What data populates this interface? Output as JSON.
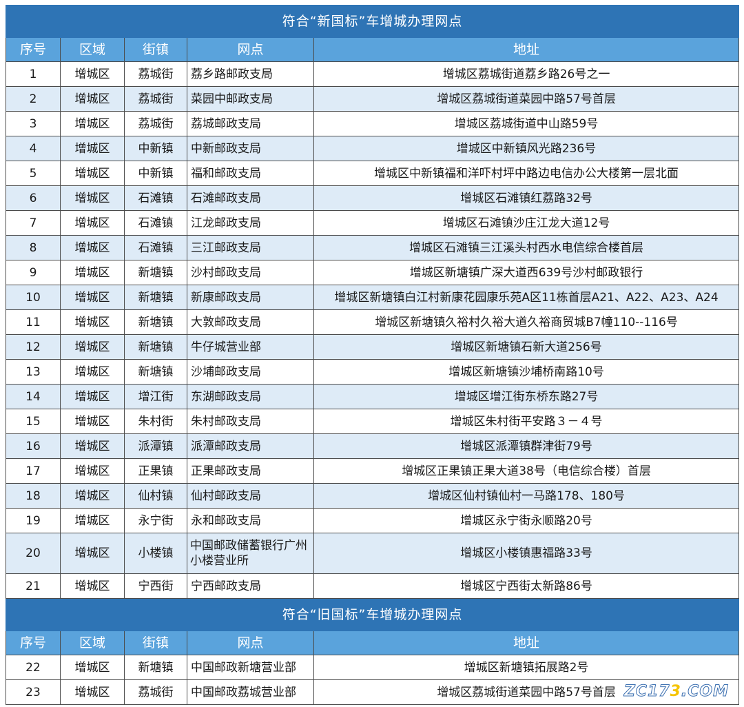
{
  "new_section": {
    "title": "符合“新国标”车增城办理网点",
    "headers": [
      "序号",
      "区域",
      "街镇",
      "网点",
      "地址"
    ],
    "rows": [
      [
        "1",
        "增城区",
        "荔城街",
        "荔乡路邮政支局",
        "增城区荔城街道荔乡路26号之一"
      ],
      [
        "2",
        "增城区",
        "荔城街",
        "菜园中邮政支局",
        "增城区荔城街道菜园中路57号首层"
      ],
      [
        "3",
        "增城区",
        "荔城街",
        "荔城邮政支局",
        "增城区荔城街道中山路59号"
      ],
      [
        "4",
        "增城区",
        "中新镇",
        "中新邮政支局",
        "增城区中新镇风光路236号"
      ],
      [
        "5",
        "增城区",
        "中新镇",
        "福和邮政支局",
        "增城区中新镇福和洋吓村坪中路边电信办公大楼第一层北面"
      ],
      [
        "6",
        "增城区",
        "石滩镇",
        "石滩邮政支局",
        "增城区石滩镇红荔路32号"
      ],
      [
        "7",
        "增城区",
        "石滩镇",
        "江龙邮政支局",
        "增城区石滩镇沙庄江龙大道12号"
      ],
      [
        "8",
        "增城区",
        "石滩镇",
        "三江邮政支局",
        "增城区石滩镇三江溪头村西水电信综合楼首层"
      ],
      [
        "9",
        "增城区",
        "新塘镇",
        "沙村邮政支局",
        "增城区新塘镇广深大道西639号沙村邮政银行"
      ],
      [
        "10",
        "增城区",
        "新塘镇",
        "新康邮政支局",
        "增城区新塘镇白江村新康花园康乐苑A区11栋首层A21、A22、A23、A24"
      ],
      [
        "11",
        "增城区",
        "新塘镇",
        "大敦邮政支局",
        "增城区新塘镇久裕村久裕大道久裕商贸城B7幢110--116号"
      ],
      [
        "12",
        "增城区",
        "新塘镇",
        "牛仔城营业部",
        "增城区新塘镇石新大道256号"
      ],
      [
        "13",
        "增城区",
        "新塘镇",
        "沙埔邮政支局",
        "增城区新塘镇沙埔桥南路10号"
      ],
      [
        "14",
        "增城区",
        "增江街",
        "东湖邮政支局",
        "增城区增江街东桥东路27号"
      ],
      [
        "15",
        "增城区",
        "朱村街",
        "朱村邮政支局",
        "增城区朱村街平安路３－４号"
      ],
      [
        "16",
        "增城区",
        "派潭镇",
        "派潭邮政支局",
        "增城区派潭镇群津街79号"
      ],
      [
        "17",
        "增城区",
        "正果镇",
        "正果邮政支局",
        "增城区正果镇正果大道38号（电信综合楼）首层"
      ],
      [
        "18",
        "增城区",
        "仙村镇",
        "仙村邮政支局",
        "增城区仙村镇仙村一马路178、180号"
      ],
      [
        "19",
        "增城区",
        "永宁街",
        "永和邮政支局",
        "增城区永宁街永顺路20号"
      ],
      [
        "20",
        "增城区",
        "小楼镇",
        "中国邮政储蓄银行广州小楼营业所",
        "增城区小楼镇惠福路33号"
      ],
      [
        "21",
        "增城区",
        "宁西街",
        "宁西邮政支局",
        "增城区宁西街太新路86号"
      ]
    ]
  },
  "old_section": {
    "title": "符合“旧国标”车增城办理网点",
    "headers": [
      "序号",
      "区域",
      "街镇",
      "网点",
      "地址"
    ],
    "rows": [
      [
        "22",
        "增城区",
        "新塘镇",
        "中国邮政新塘营业部",
        "增城区新塘镇拓展路2号"
      ],
      [
        "23",
        "增城区",
        "荔城街",
        "中国邮政荔城营业部",
        "增城区荔城街道菜园中路57号首层"
      ]
    ]
  },
  "watermark": {
    "text_a": "ZC17",
    "text_dot": "3",
    "text_b": ".COM"
  },
  "colors": {
    "title_bg": "#2e74b5",
    "header_bg": "#5aa3dc",
    "alt_row_bg": "#deebf7"
  }
}
